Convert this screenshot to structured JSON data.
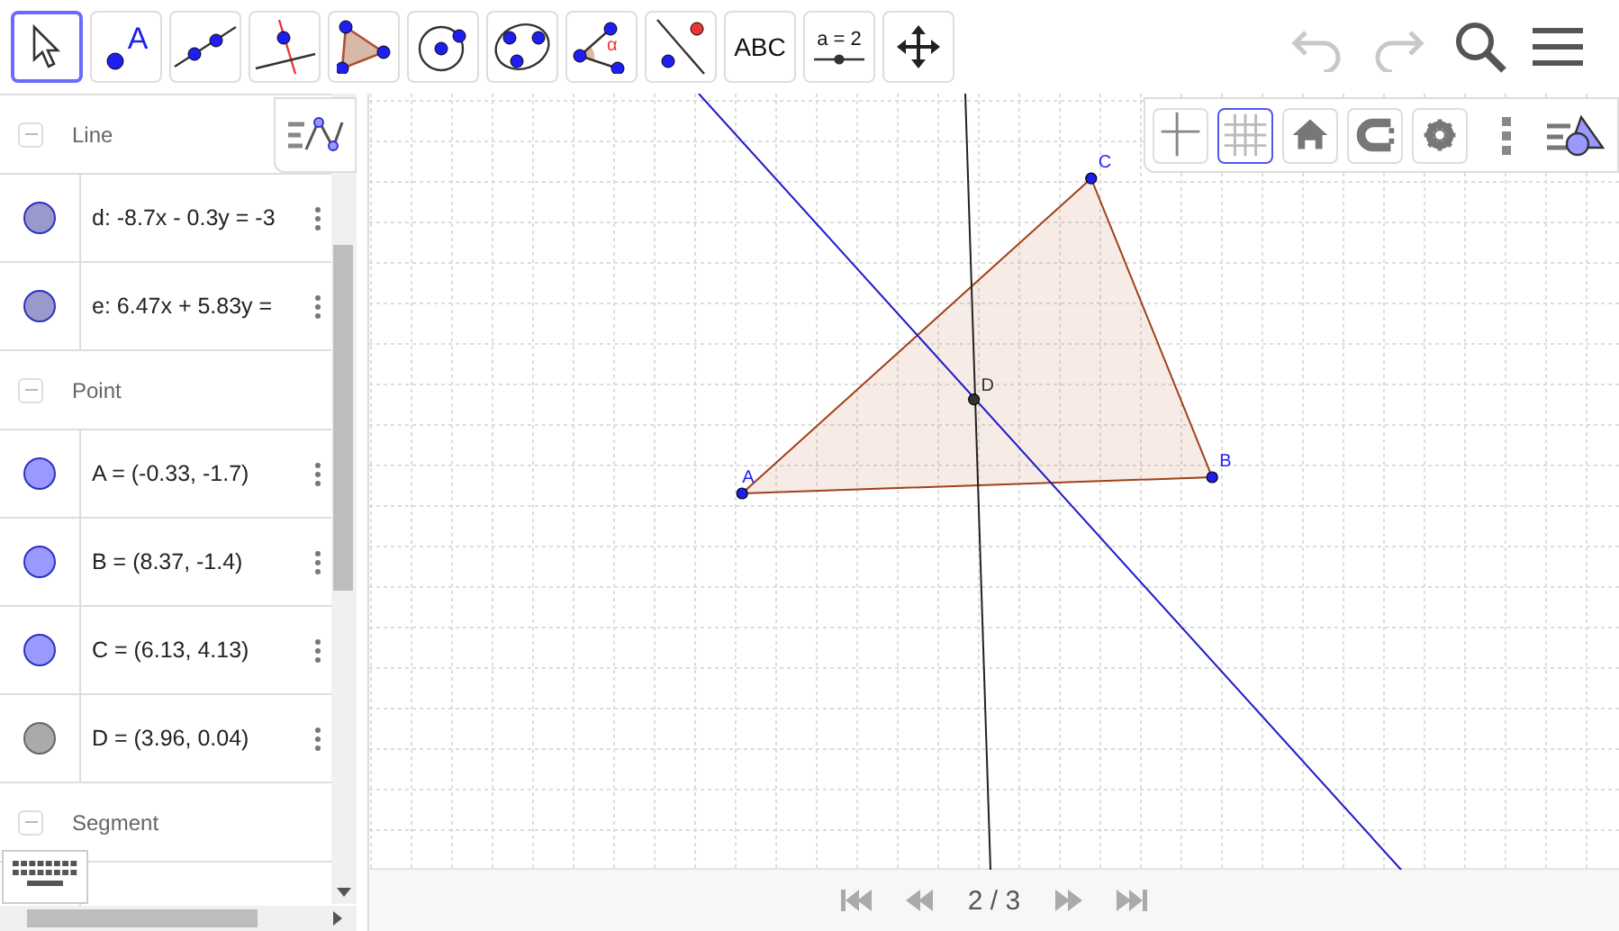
{
  "toolbar": {
    "tools": [
      {
        "kind": "move",
        "selected": true
      },
      {
        "kind": "point",
        "selected": false,
        "label": "A"
      },
      {
        "kind": "line",
        "selected": false
      },
      {
        "kind": "perpendicular",
        "selected": false
      },
      {
        "kind": "polygon",
        "selected": false
      },
      {
        "kind": "circle",
        "selected": false
      },
      {
        "kind": "conic",
        "selected": false
      },
      {
        "kind": "angle",
        "selected": false,
        "label": "α"
      },
      {
        "kind": "reflect",
        "selected": false
      },
      {
        "kind": "text",
        "selected": false,
        "label": "ABC"
      },
      {
        "kind": "slider",
        "selected": false,
        "label": "a = 2"
      },
      {
        "kind": "pan",
        "selected": false
      }
    ],
    "actions": [
      {
        "kind": "undo",
        "disabled": true
      },
      {
        "kind": "redo",
        "disabled": true
      },
      {
        "kind": "search",
        "disabled": false
      },
      {
        "kind": "menu",
        "disabled": false
      }
    ]
  },
  "algebra": {
    "groups": [
      {
        "title": "Line",
        "expanded": true,
        "items": [
          {
            "text": "d: -8.7x - 0.3y = -3",
            "color": "#9999cc"
          },
          {
            "text": "e: 6.47x + 5.83y =",
            "color": "#9999cc"
          }
        ]
      },
      {
        "title": "Point",
        "expanded": true,
        "items": [
          {
            "text": "A = (-0.33, -1.7)",
            "color": "#9999ff"
          },
          {
            "text": "B = (8.37, -1.4)",
            "color": "#9999ff"
          },
          {
            "text": "C = (6.13, 4.13)",
            "color": "#9999ff"
          },
          {
            "text": "D = (3.96, 0.04)",
            "color": "#aaaaaa"
          }
        ]
      },
      {
        "title": "Segment",
        "expanded": true
      }
    ]
  },
  "graphics": {
    "style_bar": [
      {
        "kind": "axes",
        "selected": false
      },
      {
        "kind": "grid",
        "selected": true
      },
      {
        "kind": "home",
        "selected": false
      },
      {
        "kind": "snap",
        "selected": false
      },
      {
        "kind": "settings",
        "selected": false
      }
    ],
    "points": [
      "A",
      "B",
      "C",
      "D"
    ],
    "navigation": {
      "page": "2 / 3"
    }
  }
}
